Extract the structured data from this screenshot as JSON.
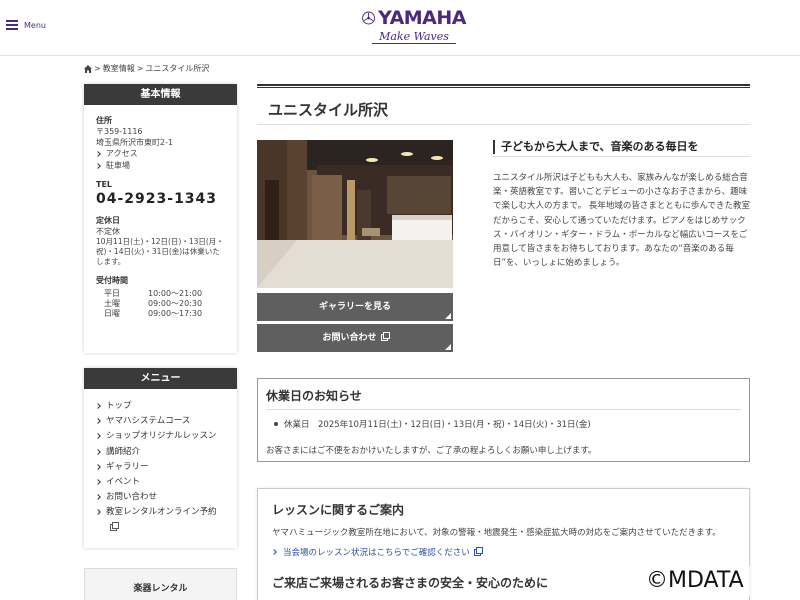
{
  "header": {
    "menu_label": "Menu",
    "brand": "YAMAHA",
    "slogan": "Make Waves"
  },
  "breadcrumb": {
    "sep1": ">",
    "classroom_info": "教室情報",
    "sep2": ">",
    "current": "ユニスタイル所沢"
  },
  "sidebar": {
    "basic_info": {
      "heading": "基本情報",
      "address_label": "住所",
      "postal": "〒359-1116",
      "address": "埼玉県所沢市東町2-1",
      "access_link": "アクセス",
      "parking_link": "駐車場",
      "tel_label": "TEL",
      "tel": "04-2923-1343",
      "closed_label": "定休日",
      "closed_value": "不定休",
      "closed_note": "10月11日(土)・12日(日)・13日(月・祝)・14日(火)・31日(金)は休業いたします。",
      "hours_label": "受付時間",
      "hours": [
        {
          "day": "平日",
          "time": "10:00〜21:00"
        },
        {
          "day": "土曜",
          "time": "09:00〜20:30"
        },
        {
          "day": "日曜",
          "time": "09:00〜17:30"
        }
      ]
    },
    "menu": {
      "heading": "メニュー",
      "items": [
        "トップ",
        "ヤマハシステムコース",
        "ショップオリジナルレッスン",
        "講師紹介",
        "ギャラリー",
        "イベント",
        "お問い合わせ",
        "教室レンタルオンライン予約"
      ]
    },
    "rental_heading": "楽器レンタル"
  },
  "main": {
    "title": "ユニスタイル所沢",
    "gallery_button": "ギャラリーを見る",
    "contact_button": "お問い合わせ",
    "lead_heading": "子どもから大人まで、音楽のある毎日を",
    "lead_text": "ユニスタイル所沢は子どもも大人も、家族みんなが楽しめる総合音楽・英語教室です。習いごとデビューの小さなお子さまから、趣味で楽しむ大人の方まで。 長年地域の皆さまとともに歩んできた教室だからこそ、安心して通っていただけます。ピアノをはじめサックス・バイオリン・ギター・ドラム・ボーカルなど幅広いコースをご用意して皆さまをお待ちしております。あなたの“音楽のある毎日”を、いっしょに始めましょう。",
    "notice": {
      "title": "休業日のお知らせ",
      "item": "休業日　2025年10月11日(土)・12日(日)・13日(月・祝)・14日(火)・31日(金)",
      "footer": "お客さまにはご不便をおかけいたしますが、ご了承の程よろしくお願い申し上げます。"
    },
    "lesson": {
      "title": "レッスンに関するご案内",
      "text": "ヤマハミュージック教室所在地において、対象の警報・地震発生・感染症拡大時の対応をご案内させていただきます。",
      "link": "当会場のレッスン状況はこちらでご確認ください",
      "title2": "ご来店ご来場されるお客さまの安全・安心のために"
    }
  },
  "watermark": "©MDATA",
  "colors": {
    "brand": "#4b2a7e",
    "sidebar_head": "#3a3a3a",
    "button": "#5f5f5f",
    "link": "#2a4f9e"
  }
}
